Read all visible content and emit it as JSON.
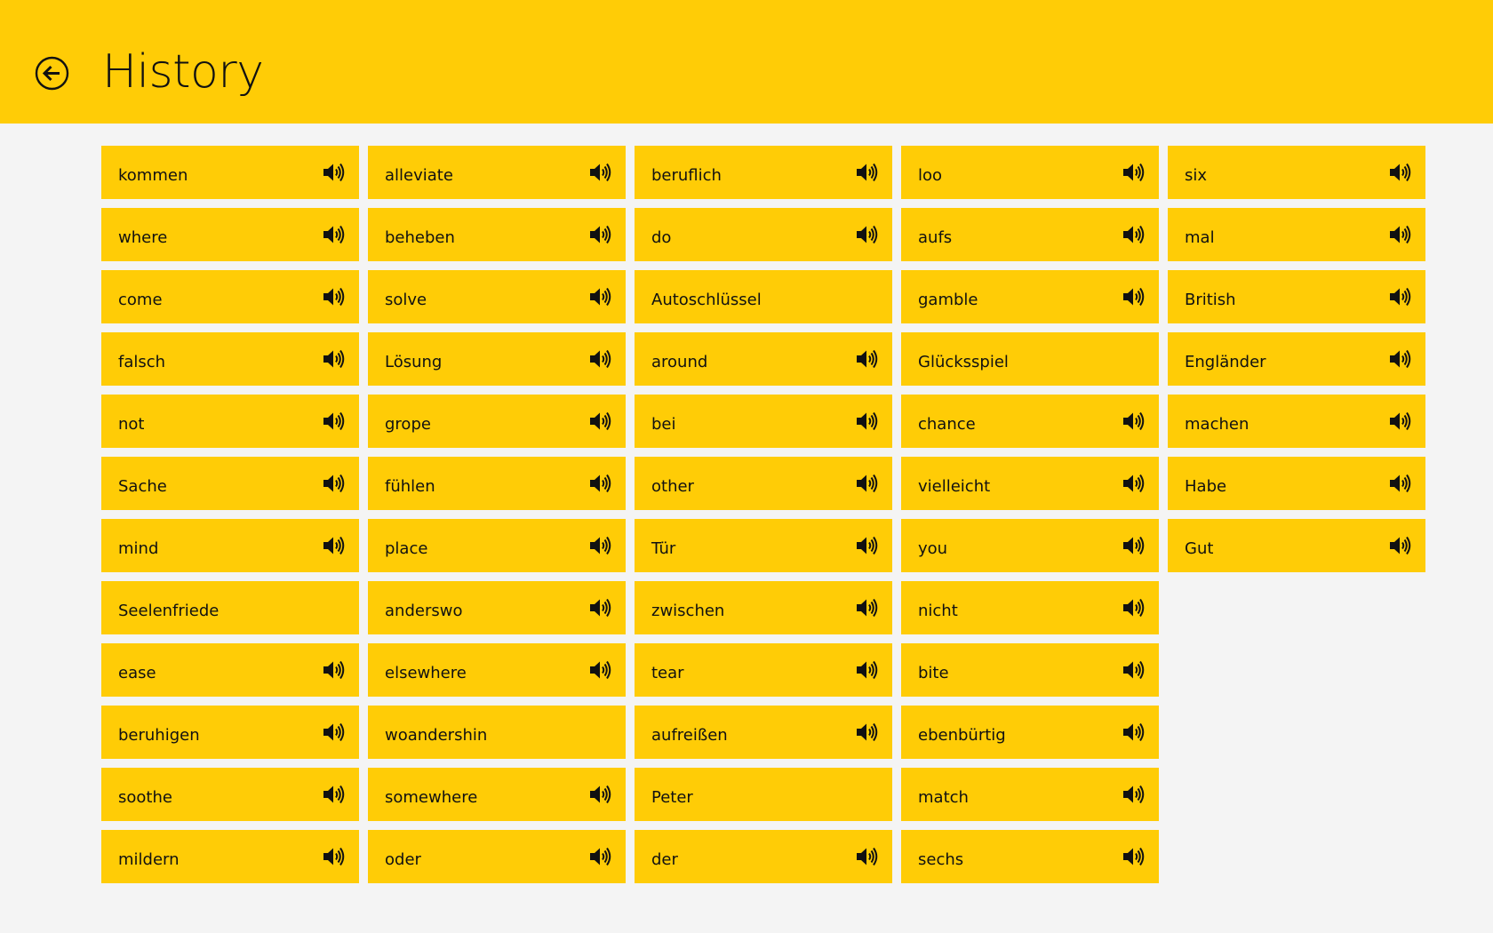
{
  "header": {
    "title": "History"
  },
  "columns": [
    [
      {
        "word": "kommen",
        "audio": true
      },
      {
        "word": "where",
        "audio": true
      },
      {
        "word": "come",
        "audio": true
      },
      {
        "word": "falsch",
        "audio": true
      },
      {
        "word": "not",
        "audio": true
      },
      {
        "word": "Sache",
        "audio": true
      },
      {
        "word": "mind",
        "audio": true
      },
      {
        "word": "Seelenfriede",
        "audio": false
      },
      {
        "word": "ease",
        "audio": true
      },
      {
        "word": "beruhigen",
        "audio": true
      },
      {
        "word": "soothe",
        "audio": true
      },
      {
        "word": "mildern",
        "audio": true
      }
    ],
    [
      {
        "word": "alleviate",
        "audio": true
      },
      {
        "word": "beheben",
        "audio": true
      },
      {
        "word": "solve",
        "audio": true
      },
      {
        "word": "Lösung",
        "audio": true
      },
      {
        "word": "grope",
        "audio": true
      },
      {
        "word": "fühlen",
        "audio": true
      },
      {
        "word": "place",
        "audio": true
      },
      {
        "word": "anderswo",
        "audio": true
      },
      {
        "word": "elsewhere",
        "audio": true
      },
      {
        "word": "woandershin",
        "audio": false
      },
      {
        "word": "somewhere",
        "audio": true
      },
      {
        "word": "oder",
        "audio": true
      }
    ],
    [
      {
        "word": "beruflich",
        "audio": true
      },
      {
        "word": "do",
        "audio": true
      },
      {
        "word": "Autoschlüssel",
        "audio": false
      },
      {
        "word": "around",
        "audio": true
      },
      {
        "word": "bei",
        "audio": true
      },
      {
        "word": "other",
        "audio": true
      },
      {
        "word": "Tür",
        "audio": true
      },
      {
        "word": "zwischen",
        "audio": true
      },
      {
        "word": "tear",
        "audio": true
      },
      {
        "word": "aufreißen",
        "audio": true
      },
      {
        "word": "Peter",
        "audio": false
      },
      {
        "word": "der",
        "audio": true
      }
    ],
    [
      {
        "word": "loo",
        "audio": true
      },
      {
        "word": "aufs",
        "audio": true
      },
      {
        "word": "gamble",
        "audio": true
      },
      {
        "word": "Glücksspiel",
        "audio": false
      },
      {
        "word": "chance",
        "audio": true
      },
      {
        "word": "vielleicht",
        "audio": true
      },
      {
        "word": "you",
        "audio": true
      },
      {
        "word": "nicht",
        "audio": true
      },
      {
        "word": "bite",
        "audio": true
      },
      {
        "word": "ebenbürtig",
        "audio": true
      },
      {
        "word": "match",
        "audio": true
      },
      {
        "word": "sechs",
        "audio": true
      }
    ],
    [
      {
        "word": "six",
        "audio": true
      },
      {
        "word": "mal",
        "audio": true
      },
      {
        "word": "British",
        "audio": true
      },
      {
        "word": "Engländer",
        "audio": true
      },
      {
        "word": "machen",
        "audio": true
      },
      {
        "word": "Habe",
        "audio": true
      },
      {
        "word": "Gut",
        "audio": true
      }
    ]
  ],
  "colors": {
    "accent": "#ffcc06",
    "background": "#f4f4f4",
    "text": "#111111"
  },
  "icons": {
    "back": "back-arrow-circle-icon",
    "audio": "speaker-icon"
  }
}
